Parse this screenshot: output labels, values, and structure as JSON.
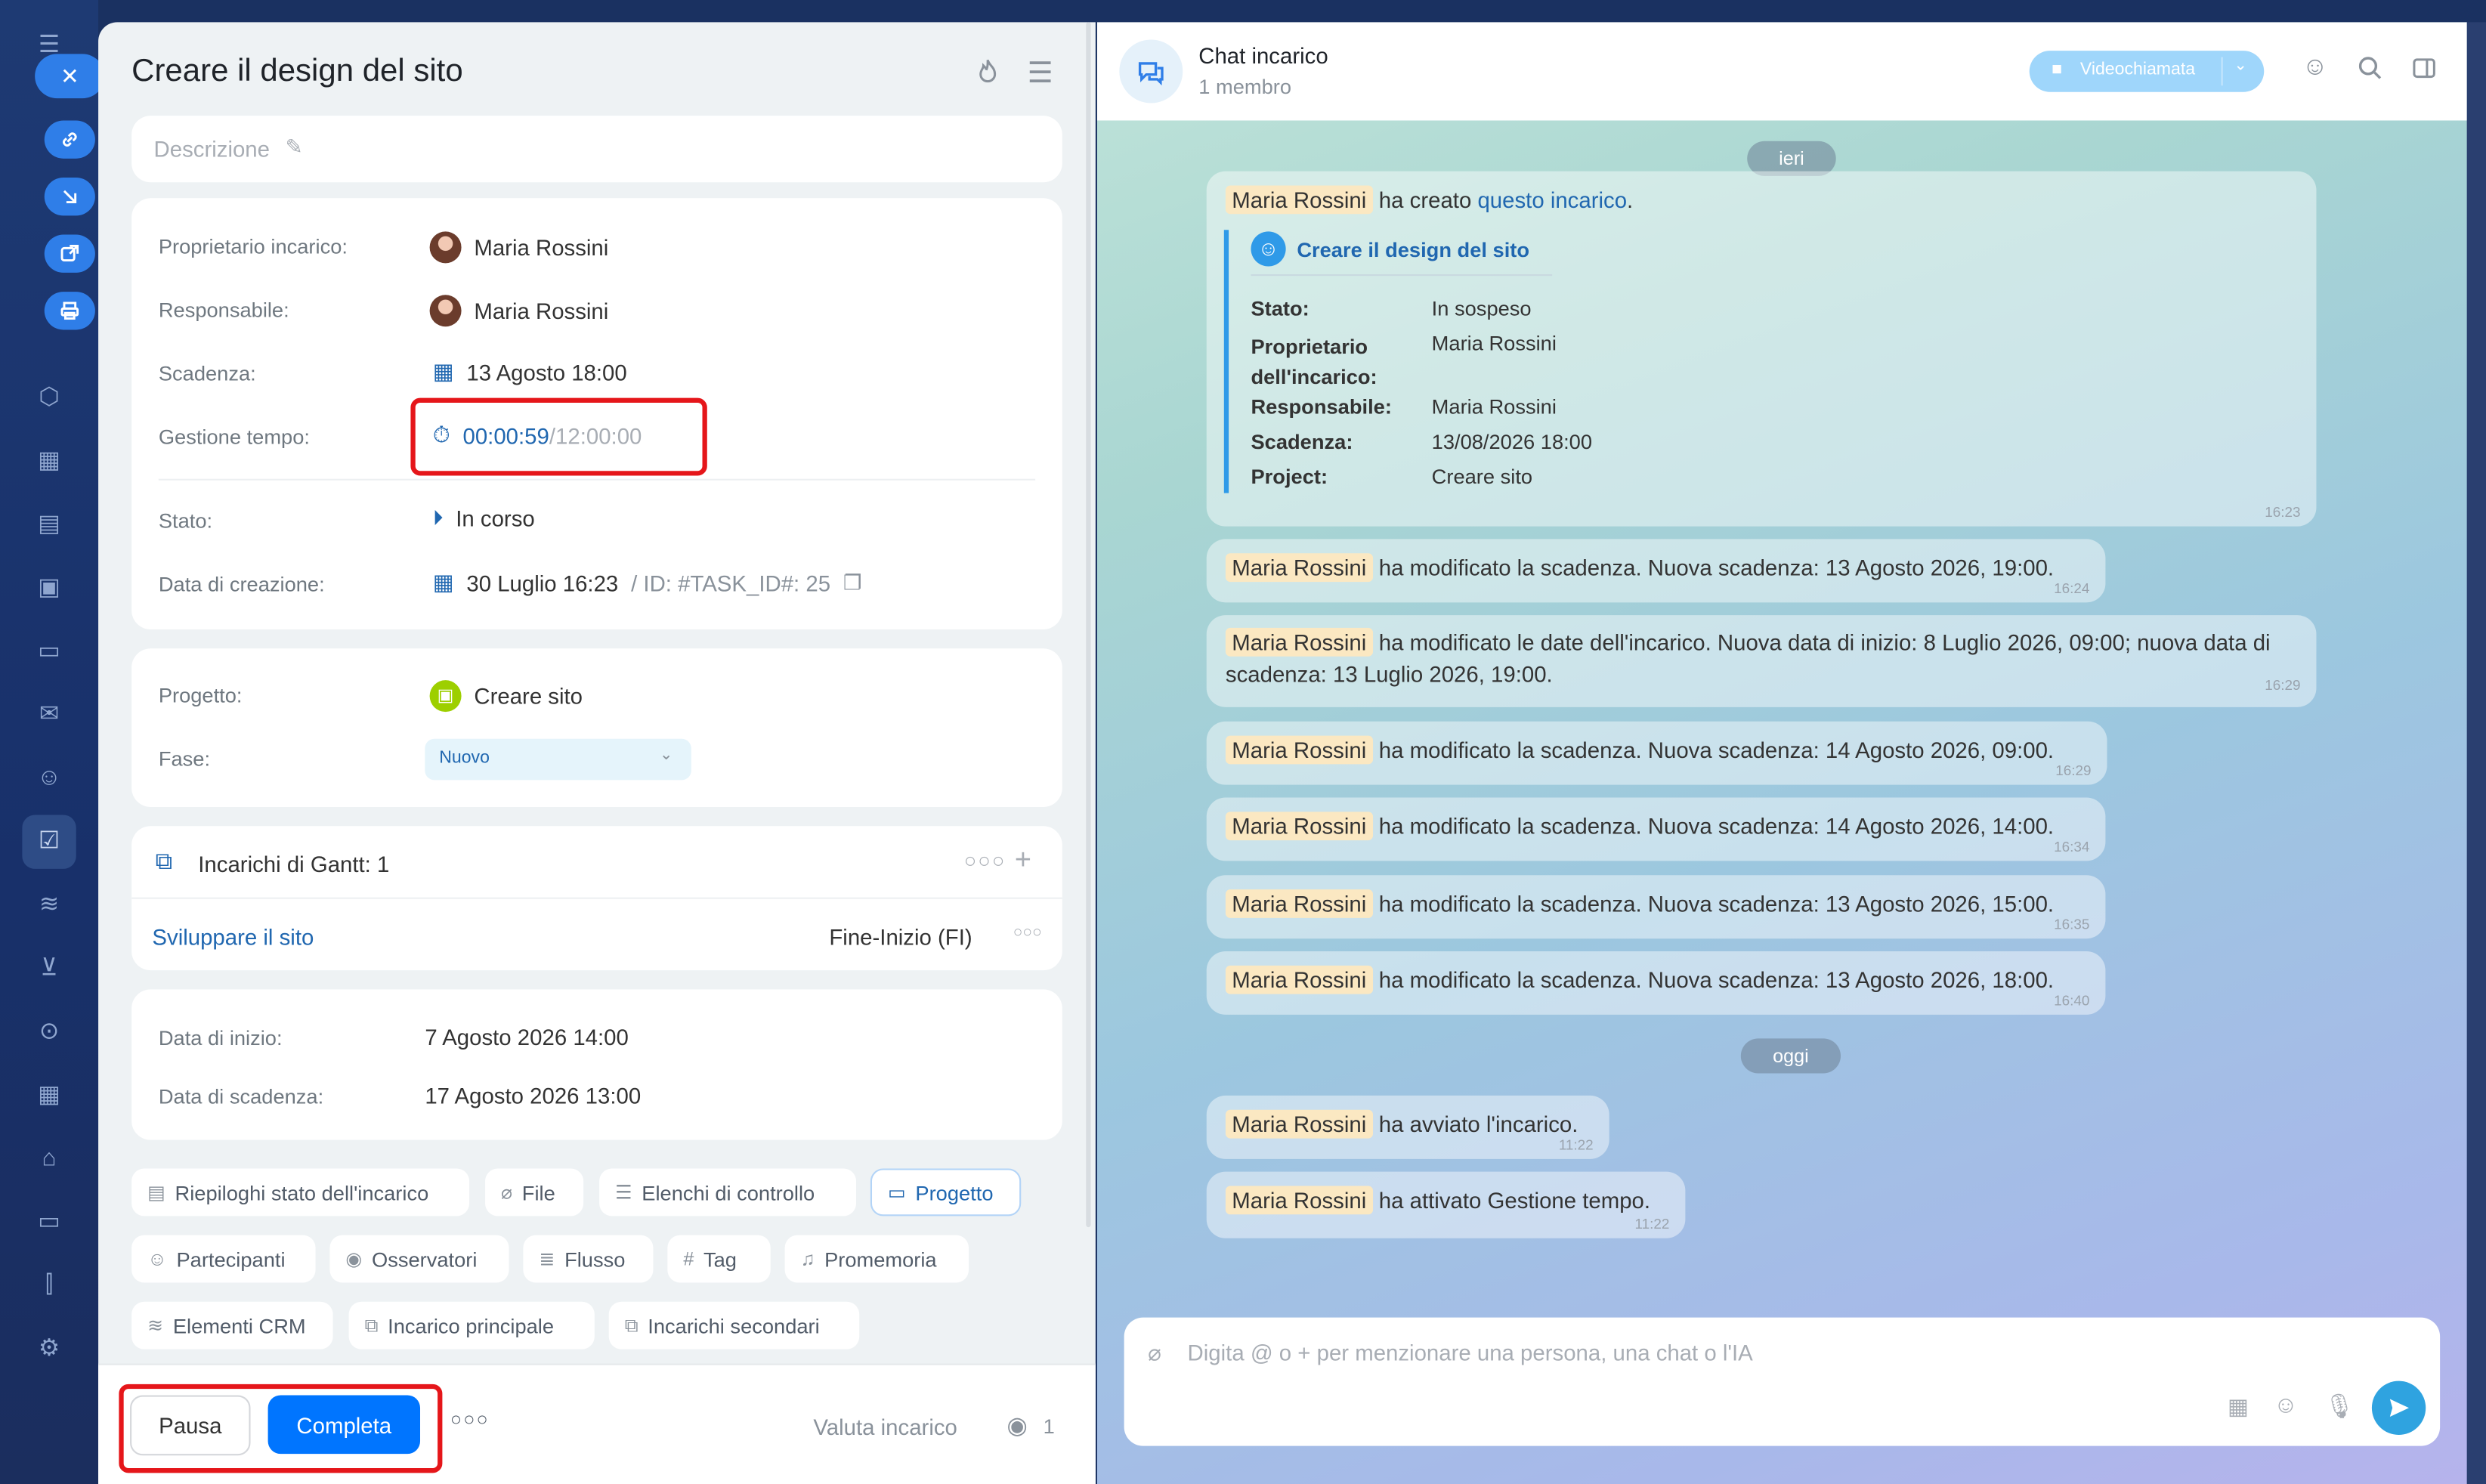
{
  "task": {
    "title": "Creare il design del sito",
    "description_placeholder": "Descrizione",
    "fields": {
      "owner_label": "Proprietario incarico:",
      "owner": "Maria Rossini",
      "responsible_label": "Responsabile:",
      "responsible": "Maria Rossini",
      "deadline_label": "Scadenza:",
      "deadline": "13 Agosto 18:00",
      "time_label": "Gestione tempo:",
      "time_elapsed": "00:00:59",
      "time_total": "/12:00:00",
      "status_label": "Stato:",
      "status": "In corso",
      "created_label": "Data di creazione:",
      "created": "30 Luglio 16:23",
      "task_id": "/  ID: #TASK_ID#: 25"
    },
    "project": {
      "project_label": "Progetto:",
      "project": "Creare sito",
      "phase_label": "Fase:",
      "phase": "Nuovo"
    },
    "gantt": {
      "title": "Incarichi di Gantt: 1",
      "item": "Sviluppare il sito",
      "relation": "Fine-Inizio (FI)"
    },
    "dates": {
      "start_label": "Data di inizio:",
      "start": "7 Agosto 2026 14:00",
      "end_label": "Data di scadenza:",
      "end": "17 Agosto 2026 13:00"
    },
    "chips": [
      "Riepiloghi stato dell'incarico",
      "File",
      "Elenchi di controllo",
      "Progetto",
      "Partecipanti",
      "Osservatori",
      "Flusso",
      "Tag",
      "Promemoria",
      "Elementi CRM",
      "Incarico principale",
      "Incarichi secondari"
    ],
    "footer": {
      "pause": "Pausa",
      "complete": "Completa",
      "rate": "Valuta incarico",
      "views": "1"
    }
  },
  "chat": {
    "title": "Chat incarico",
    "members": "1 membro",
    "video_call": "Videochiamata",
    "date_yesterday": "ieri",
    "date_today": "oggi",
    "author": "Maria Rossini",
    "created_msg": {
      "text": "ha creato",
      "link": "questo incarico",
      "dot": ".",
      "task_title": "Creare il design del sito",
      "rows": [
        {
          "label": "Stato:",
          "value": "In sospeso"
        },
        {
          "label": "Proprietario dell'incarico:",
          "value": "Maria Rossini"
        },
        {
          "label": "Responsabile:",
          "value": "Maria Rossini"
        },
        {
          "label": "Scadenza:",
          "value": "13/08/2026 18:00"
        },
        {
          "label": "Project:",
          "value": "Creare sito"
        }
      ],
      "time": "16:23"
    },
    "messages": [
      {
        "text": "ha modificato la scadenza. Nuova scadenza: 13 Agosto 2026, 19:00.",
        "time": "16:24"
      },
      {
        "text": "ha modificato le date dell'incarico. Nuova data di inizio: 8 Luglio 2026, 09:00; nuova data di scadenza: 13 Luglio 2026, 19:00.",
        "time": "16:29"
      },
      {
        "text": "ha modificato la scadenza. Nuova scadenza: 14 Agosto 2026, 09:00.",
        "time": "16:29"
      },
      {
        "text": "ha modificato la scadenza. Nuova scadenza: 14 Agosto 2026, 14:00.",
        "time": "16:34"
      },
      {
        "text": "ha modificato la scadenza. Nuova scadenza: 13 Agosto 2026, 15:00.",
        "time": "16:35"
      },
      {
        "text": "ha modificato la scadenza. Nuova scadenza: 13 Agosto 2026, 18:00.",
        "time": "16:40"
      },
      {
        "text": "ha avviato l'incarico.",
        "time": "11:22"
      },
      {
        "text": "ha attivato Gestione tempo.",
        "time": "11:22"
      }
    ],
    "input_placeholder": "Digita @ o + per menzionare una persona, una chat o l'IA"
  },
  "colors": {
    "accent": "#0075ff",
    "highlight": "#e5161a",
    "link": "#2067b0"
  }
}
